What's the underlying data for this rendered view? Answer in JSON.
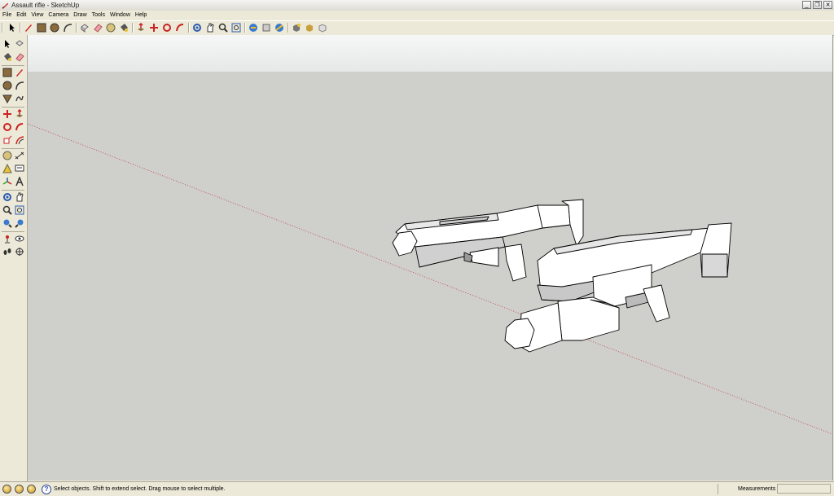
{
  "window": {
    "title": "Assault rifle - SketchUp",
    "minimize": "_",
    "maximize": "❐",
    "close": "✕"
  },
  "menu": [
    {
      "label": "File"
    },
    {
      "label": "Edit"
    },
    {
      "label": "View"
    },
    {
      "label": "Camera"
    },
    {
      "label": "Draw"
    },
    {
      "label": "Tools"
    },
    {
      "label": "Window"
    },
    {
      "label": "Help"
    }
  ],
  "toolbar_icons": [
    "select-icon",
    "pencil-icon",
    "rectangle-icon",
    "circle-icon",
    "arc-icon",
    "make-component-icon",
    "eraser-icon",
    "paint-bucket-icon",
    "push-pull-icon",
    "move-icon",
    "rotate-icon",
    "follow-me-icon",
    "orbit-icon",
    "pan-icon",
    "zoom-icon",
    "zoom-extents-icon",
    "get-models-icon",
    "share-model-icon",
    "share-component-icon",
    "google-earth-icon",
    "get-photo-texture-icon",
    "preview-icon"
  ],
  "status": {
    "text": "Select objects. Shift to extend select. Drag mouse to select multiple.",
    "help": "?",
    "measurements_label": "Measurements",
    "measurements_value": ""
  },
  "colors": {
    "viewport_ground": "#cfcfcb",
    "sky": "#f2f3f3",
    "axis_red": "#c04040",
    "model_edge": "#000000",
    "model_face": "#ffffff",
    "model_shade": "#b8b8b8"
  }
}
